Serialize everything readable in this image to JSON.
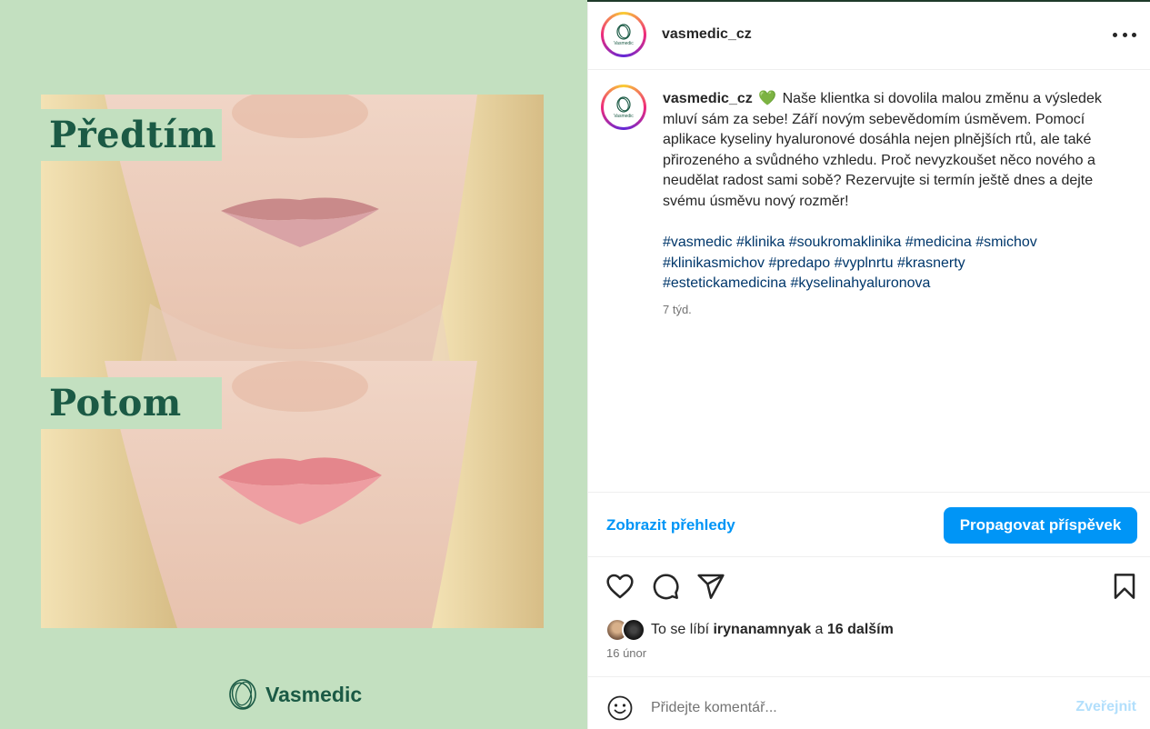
{
  "media": {
    "before_label": "Předtím",
    "after_label": "Potom",
    "brand_name": "Vasmedic",
    "background_color": "#c3e0c0",
    "brand_color": "#1b5a45"
  },
  "header": {
    "username": "vasmedic_cz",
    "avatar_text": "Vasmedic"
  },
  "caption": {
    "username": "vasmedic_cz",
    "emoji": "💚",
    "text": "Naše klientka si dovolila malou změnu a výsledek mluví sám za sebe! Září novým sebevědomím úsměvem. Pomocí aplikace kyseliny hyaluronové dosáhla nejen plnějších rtů, ale také přirozeného a svůdného vzhledu. Proč nevyzkoušet něco nového a neudělat radost sami sobě? Rezervujte si termín ještě dnes a dejte svému úsměvu nový rozměr!",
    "hashtags": [
      "#vasmedic",
      "#klinika",
      "#soukromaklinika",
      "#medicina",
      "#smichov",
      "#klinikasmichov",
      "#predapo",
      "#vyplnrtu",
      "#krasnerty",
      "#esteticka​medicina",
      "#kyselinahyaluronova"
    ],
    "time_ago": "7 týd."
  },
  "promo": {
    "insights_label": "Zobrazit přehledy",
    "boost_label": "Propagovat příspěvek",
    "accent_color": "#0095f6"
  },
  "actions": {
    "like_icon": "heart-icon",
    "comment_icon": "comment-icon",
    "share_icon": "paper-plane-icon",
    "save_icon": "bookmark-icon"
  },
  "likes": {
    "prefix": "To se líbí",
    "user": "irynanamnyak",
    "conjunction": "a",
    "others": "16 dalším"
  },
  "date": "16 únor",
  "comment": {
    "placeholder": "Přidejte komentář...",
    "post_label": "Zveřejnit"
  }
}
